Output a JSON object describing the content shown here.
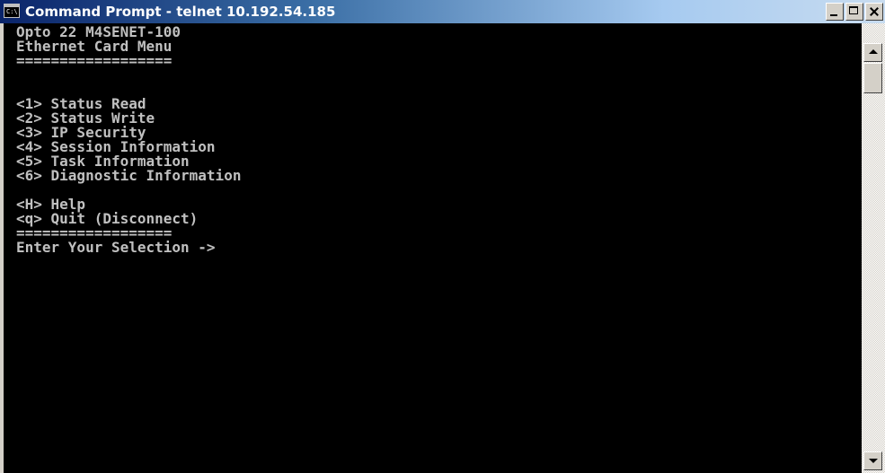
{
  "window": {
    "title": "Command Prompt - telnet 10.192.54.185",
    "icon": "console-app-icon",
    "icon_label": "C:\\"
  },
  "console": {
    "lines": [
      "Opto 22 M4SENET-100",
      "Ethernet Card Menu",
      "==================",
      "",
      "",
      "<1> Status Read",
      "<2> Status Write",
      "<3> IP Security",
      "<4> Session Information",
      "<5> Task Information",
      "<6> Diagnostic Information",
      "",
      "<H> Help",
      "<q> Quit (Disconnect)",
      "==================",
      "Enter Your Selection ->"
    ]
  },
  "colors": {
    "console_bg": "#000000",
    "console_fg": "#c0c0c0",
    "titlebar_start": "#0a246a",
    "titlebar_end": "#a6caf0"
  }
}
